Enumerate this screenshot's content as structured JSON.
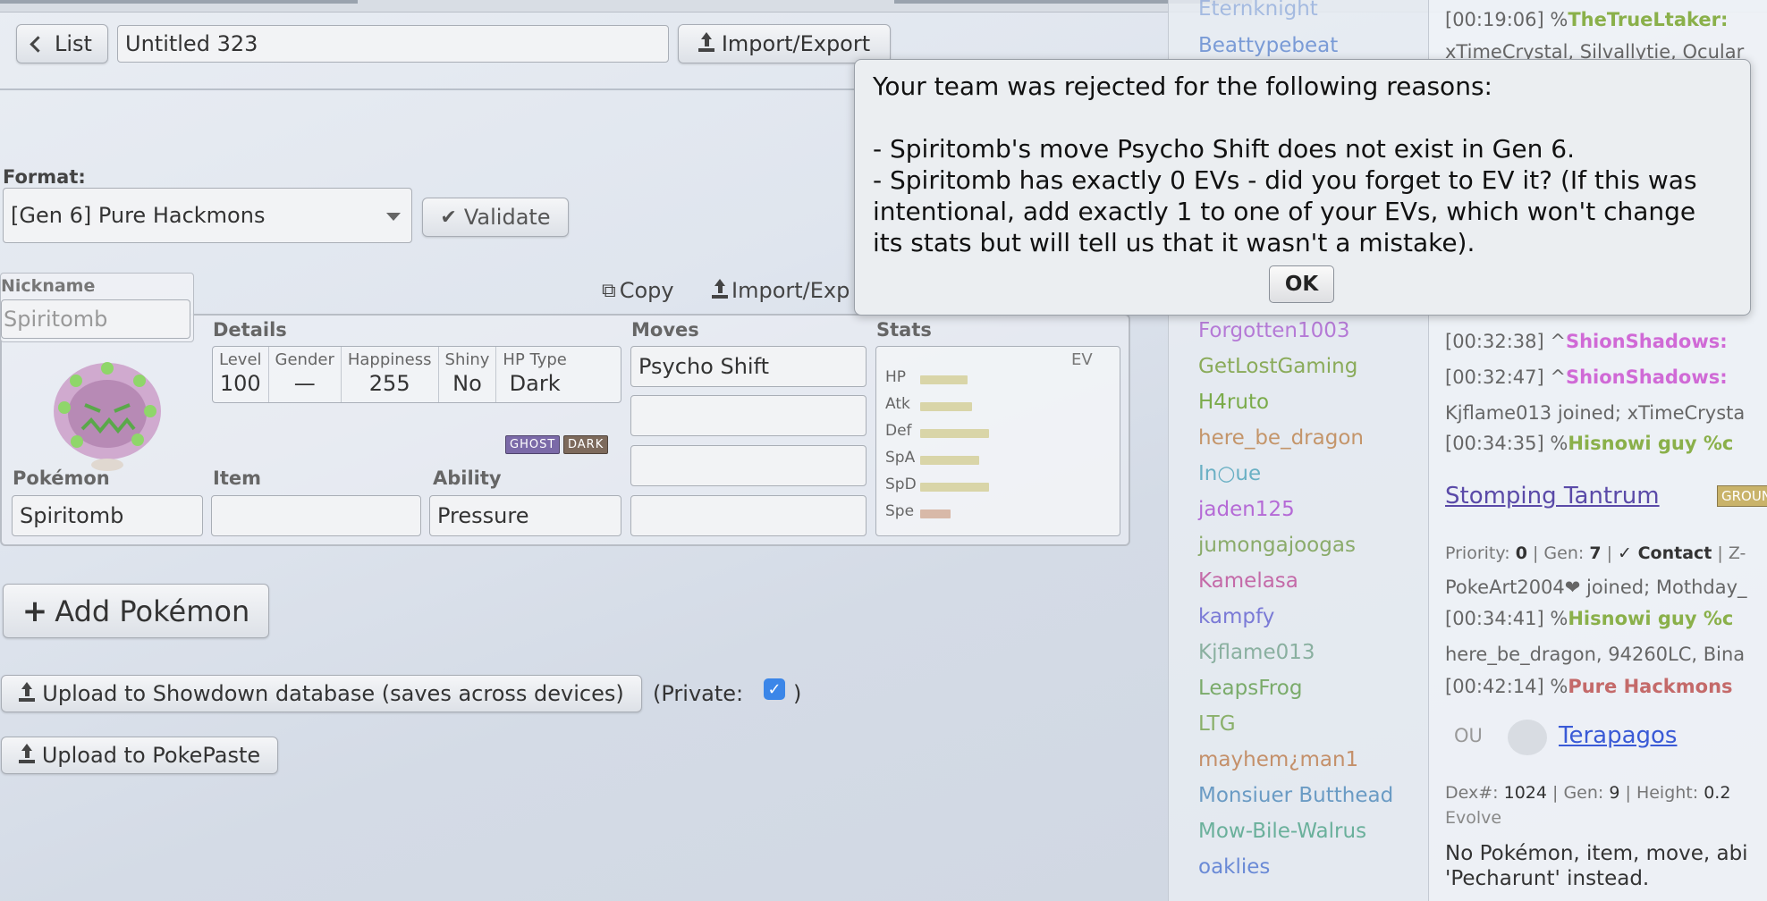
{
  "toolbar": {
    "list_label": "List",
    "team_name": "Untitled 323",
    "import_export_label": "Import/Export"
  },
  "format": {
    "label": "Format:",
    "selected": "[Gen 6] Pure Hackmons",
    "validate_label": "Validate"
  },
  "pokemon": {
    "nickname_label": "Nickname",
    "nickname": "Spiritomb",
    "copy_label": "Copy",
    "import_export_label": "Import/Exp",
    "details": {
      "title": "Details",
      "level_label": "Level",
      "level": "100",
      "gender_label": "Gender",
      "gender": "—",
      "happiness_label": "Happiness",
      "happiness": "255",
      "shiny_label": "Shiny",
      "shiny": "No",
      "hptype_label": "HP Type",
      "hptype": "Dark"
    },
    "types": [
      "GHOST",
      "DARK"
    ],
    "type_colors": {
      "ghost": "#7b6aa8",
      "dark": "#7d6a5c"
    },
    "species_label": "Pokémon",
    "species": "Spiritomb",
    "item_label": "Item",
    "item": "",
    "ability_label": "Ability",
    "ability": "Pressure",
    "moves_title": "Moves",
    "moves": [
      "Psycho Shift",
      "",
      "",
      ""
    ],
    "stats_title": "Stats",
    "ev_label": "EV",
    "stats": [
      {
        "name": "HP",
        "level": 0.33,
        "color": "#d9d5a8"
      },
      {
        "name": "Atk",
        "level": 0.36,
        "color": "#d9d5a8"
      },
      {
        "name": "Def",
        "level": 0.48,
        "color": "#d9d5a8"
      },
      {
        "name": "SpA",
        "level": 0.41,
        "color": "#d9d5a8"
      },
      {
        "name": "SpD",
        "level": 0.48,
        "color": "#d9d5a8"
      },
      {
        "name": "Spe",
        "level": 0.21,
        "color": "#d8b9a8"
      }
    ]
  },
  "actions": {
    "add_pokemon": "Add Pokémon",
    "upload_db": "Upload to Showdown database (saves across devices)",
    "private_open": "(Private:",
    "private_close": ")",
    "private_checked": true,
    "upload_pokepaste": "Upload to PokePaste"
  },
  "dialog": {
    "message": "Your team was rejected for the following reasons:\n\n- Spiritomb's move Psycho Shift does not exist in Gen 6.\n- Spiritomb has exactly 0 EVs - did you forget to EV it? (If this was intentional, add exactly 1 to one of your EVs, which won't change its stats but will tell us that it wasn't a mistake).",
    "ok_label": "OK"
  },
  "userlist": [
    {
      "name": "Beattypebeat",
      "color": "#7a9bd6"
    },
    {
      "name": "Forgotten1003",
      "color": "#b57ad6"
    },
    {
      "name": "GetLostGaming",
      "color": "#8aab5a"
    },
    {
      "name": "H4ruto",
      "color": "#7aab4a"
    },
    {
      "name": "here_be_dragon",
      "color": "#c4956a"
    },
    {
      "name": "In○ue",
      "color": "#6ab0c4"
    },
    {
      "name": "jaden125",
      "color": "#b56ad6"
    },
    {
      "name": "jumongajoogas",
      "color": "#8aab6a"
    },
    {
      "name": "Kamelasa",
      "color": "#c46aa8"
    },
    {
      "name": "kampfy",
      "color": "#7a7ad6"
    },
    {
      "name": "Kjflame013",
      "color": "#8ab0a0"
    },
    {
      "name": "LeapsFrog",
      "color": "#7aab6a"
    },
    {
      "name": "LTG",
      "color": "#8ab06a"
    },
    {
      "name": "mayhem¿man1",
      "color": "#c4906a"
    },
    {
      "name": "Monsiuer Butthead",
      "color": "#6a9bc4"
    },
    {
      "name": "Mow-Bile-Walrus",
      "color": "#6ab09b"
    },
    {
      "name": "oaklies",
      "color": "#6a8ad6"
    }
  ],
  "chat": {
    "lines": [
      {
        "time": "[00:19:06]",
        "rank": "%",
        "name": "TheTrueLtaker:",
        "color": "#8ab04a"
      },
      {
        "text": "xTimeCrystal, Silvallytie, Ocular"
      },
      {
        "time": "[00:32:38]",
        "rank": "^",
        "name": "ShionShadows:",
        "color": "#d06ad6"
      },
      {
        "time": "[00:32:47]",
        "rank": "^",
        "name": "ShionShadows:",
        "color": "#d06ad6"
      },
      {
        "text": "Kjflame013 joined; xTimeCrysta"
      },
      {
        "time": "[00:34:35]",
        "rank": "%",
        "name": "Hisnowi guy %c",
        "color": "#8ab04a"
      }
    ],
    "move_link": "Stomping Tantrum",
    "move_type_badge": "GROUND",
    "move_priority_label": "Priority:",
    "move_priority": "0",
    "move_gen_label": "Gen:",
    "move_gen": "7",
    "move_contact": "✓ Contact",
    "move_z": "Z-",
    "lines2": [
      {
        "text": "PokeArt2004❤ joined; Mothday_"
      },
      {
        "time": "[00:34:41]",
        "rank": "%",
        "name": "Hisnowi guy %c",
        "color": "#8ab04a"
      },
      {
        "text": "here_be_dragon, 94260LC, Bina"
      },
      {
        "time": "[00:42:14]",
        "rank": "%",
        "name": "Pure Hackmons",
        "color": "#c46a6a"
      }
    ],
    "tier": "OU",
    "poke_link": "Terapagos",
    "dex_label": "Dex#:",
    "dex": "1024",
    "gen_label": "Gen:",
    "gen": "9",
    "height_label": "Height:",
    "height": "0.2",
    "evolve_label": "Evolve",
    "notfound": "No Pokémon, item, move, abi",
    "notfound2": "'Pecharunt' instead."
  }
}
